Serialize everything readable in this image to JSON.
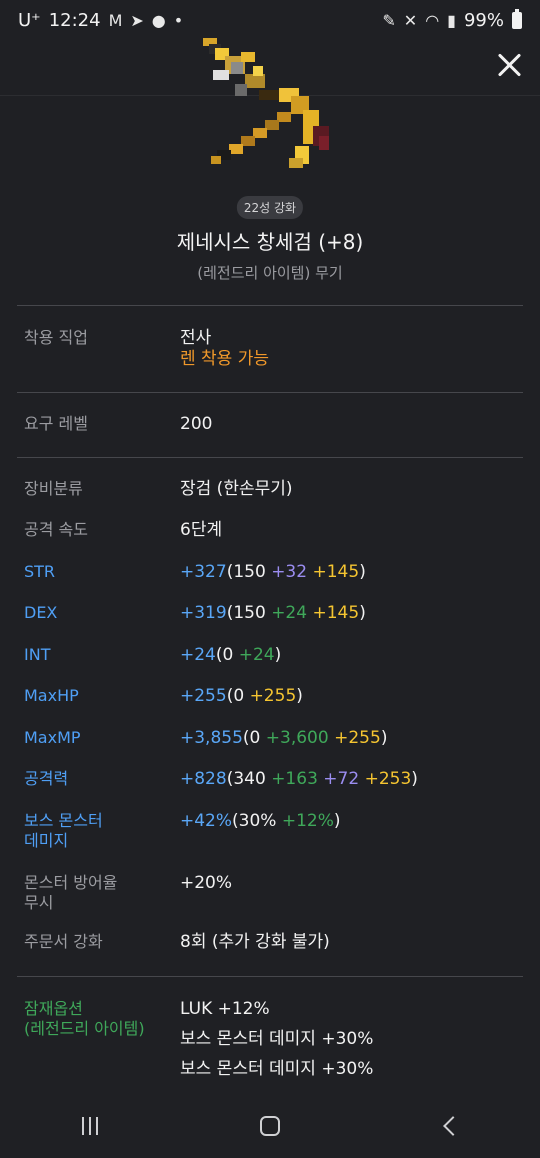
{
  "status_bar": {
    "carrier": "U⁺",
    "time": "12:24",
    "battery": "99%"
  },
  "item": {
    "star_force": "22성 강화",
    "name": "제네시스 창세검 (+8)",
    "type": "(레전드리 아이템) 무기"
  },
  "job": {
    "label": "착용 직업",
    "value": "전사",
    "note": "렌 착용 가능"
  },
  "level": {
    "label": "요구 레벨",
    "value": "200"
  },
  "stats": {
    "category": {
      "label": "장비분류",
      "value": "장검 (한손무기)"
    },
    "attack_speed": {
      "label": "공격 속도",
      "value": "6단계"
    },
    "str": {
      "label": "STR",
      "total": "+327",
      "open": "(150 ",
      "p1": "+32",
      "sp": " ",
      "p2": "+145",
      "close": ")"
    },
    "dex": {
      "label": "DEX",
      "total": "+319",
      "open": "(150 ",
      "p1": "+24",
      "sp": " ",
      "p2": "+145",
      "close": ")"
    },
    "int": {
      "label": "INT",
      "total": "+24",
      "open": "(0 ",
      "p1": "+24",
      "close": ")"
    },
    "maxhp": {
      "label": "MaxHP",
      "total": "+255",
      "open": "(0 ",
      "p1": "+255",
      "close": ")"
    },
    "maxmp": {
      "label": "MaxMP",
      "total": "+3,855",
      "open": "(0 ",
      "p1": "+3,600",
      "sp": " ",
      "p2": "+255",
      "close": ")"
    },
    "attack": {
      "label": "공격력",
      "total": "+828",
      "open": "(340 ",
      "p1": "+163",
      "sp1": " ",
      "p2": "+72",
      "sp2": " ",
      "p3": "+253",
      "close": ")"
    },
    "boss_damage": {
      "label_1": "보스 몬스터",
      "label_2": "데미지",
      "total": "+42%",
      "open": "(30% ",
      "p1": "+12%",
      "close": ")"
    },
    "ignore_def": {
      "label_1": "몬스터 방어율",
      "label_2": "무시",
      "value": "+20%"
    },
    "scroll": {
      "label": "주문서 강화",
      "value": "8회 (추가 강화 불가)"
    }
  },
  "potential": {
    "label_1": "잠재옵션",
    "label_2": "(레전드리 아이템)",
    "lines": [
      "LUK +12%",
      "보스 몬스터 데미지 +30%",
      "보스 몬스터 데미지 +30%"
    ]
  },
  "colors": {
    "background": "#1f2024",
    "blue": "#5aa7f7",
    "purple": "#9b8df0",
    "yellow": "#f5c531",
    "green": "#3fa85a",
    "orange": "#f0982a"
  }
}
